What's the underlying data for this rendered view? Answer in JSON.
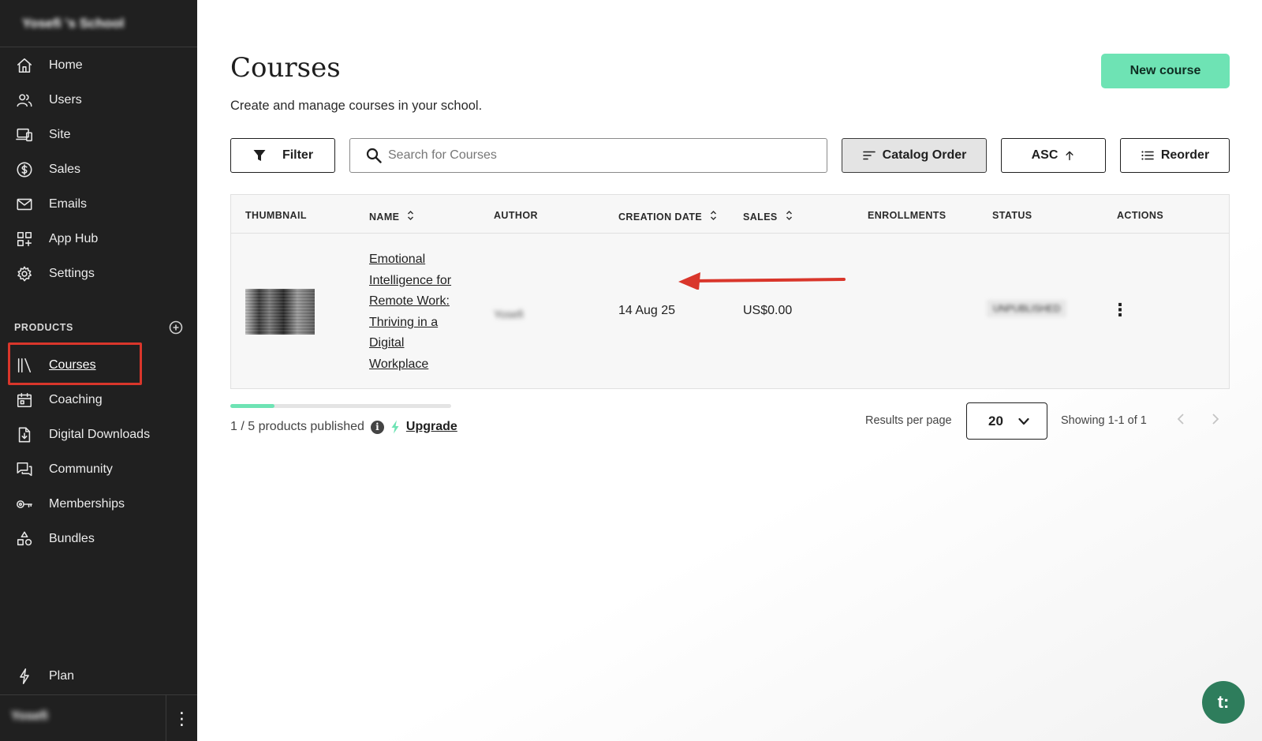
{
  "sidebar": {
    "school_name": "Yosefi 's School",
    "nav": [
      {
        "label": "Home",
        "icon": "home-icon"
      },
      {
        "label": "Users",
        "icon": "users-icon"
      },
      {
        "label": "Site",
        "icon": "devices-icon"
      },
      {
        "label": "Sales",
        "icon": "dollar-icon"
      },
      {
        "label": "Emails",
        "icon": "mail-icon"
      },
      {
        "label": "App Hub",
        "icon": "apps-icon"
      },
      {
        "label": "Settings",
        "icon": "gear-icon"
      }
    ],
    "products_title": "PRODUCTS",
    "products": [
      {
        "label": "Courses",
        "icon": "library-icon",
        "active": true
      },
      {
        "label": "Coaching",
        "icon": "calendar-icon"
      },
      {
        "label": "Digital Downloads",
        "icon": "file-download-icon"
      },
      {
        "label": "Community",
        "icon": "chat-icon"
      },
      {
        "label": "Memberships",
        "icon": "key-icon"
      },
      {
        "label": "Bundles",
        "icon": "shapes-icon"
      }
    ],
    "plan_label": "Plan",
    "user_name": "Yosefi",
    "user_menu_icon": "⋮"
  },
  "main": {
    "title": "Courses",
    "subtitle": "Create and manage courses in your school.",
    "new_course_label": "New course",
    "toolbar": {
      "filter_label": "Filter",
      "search_placeholder": "Search for Courses",
      "catalog_label": "Catalog Order",
      "asc_label": "ASC",
      "reorder_label": "Reorder"
    },
    "table": {
      "columns": [
        "THUMBNAIL",
        "NAME",
        "AUTHOR",
        "CREATION DATE",
        "SALES",
        "ENROLLMENTS",
        "STATUS",
        "ACTIONS"
      ],
      "rows": [
        {
          "name": "Emotional Intelligence for Remote Work: Thriving in a Digital Workplace",
          "author": "Yosefi",
          "creation_date": "14 Aug 25",
          "sales": "US$0.00",
          "enrollments": "",
          "status": "UNPUBLISHED",
          "actions_icon": "⋮"
        }
      ]
    },
    "footer": {
      "published_text": "1 / 5 products published",
      "published_fraction": 0.2,
      "upgrade_label": "Upgrade",
      "results_per_page_label": "Results per page",
      "results_per_page_value": "20",
      "showing_text": "Showing 1-1 of 1"
    },
    "chat_label": "t:"
  },
  "colors": {
    "sidebar_bg": "#202020",
    "accent": "#6ee3b4",
    "highlight": "#d9362b",
    "chat": "#2e7d5c"
  }
}
